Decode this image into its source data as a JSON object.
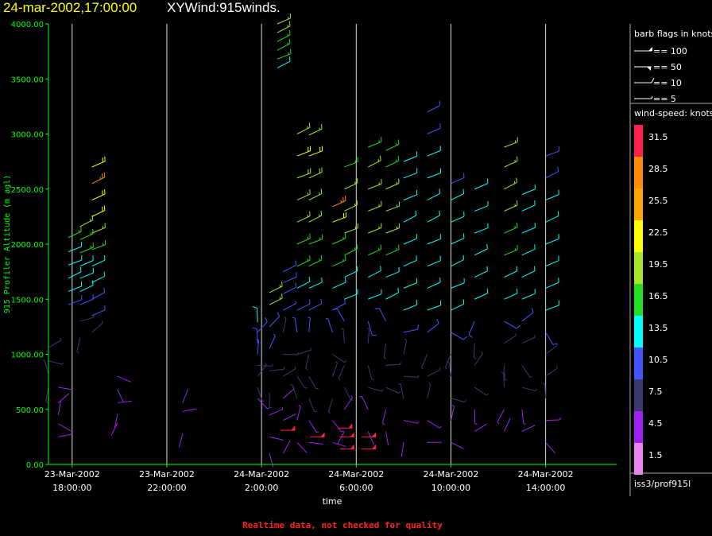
{
  "header": {
    "title_date": "24-mar-2002,17:00:00",
    "title_name": "XYWind:915winds."
  },
  "footer": {
    "quality_note": "Realtime data, not checked for quality"
  },
  "colors": {
    "background": "#000000",
    "axis": "#00ff00",
    "grid": "#ffffff",
    "title_date": "#ffff00",
    "quality_note": "#ff2222"
  },
  "chart_data": {
    "type": "wind-barb",
    "xlabel": "time",
    "ylabel": "915 Profiler Altitude (m agl)",
    "y_ticks": [
      "0.00",
      "500.00",
      "1000.00",
      "1500.00",
      "2000.00",
      "2500.00",
      "3000.00",
      "3500.00",
      "4000.00"
    ],
    "ylim": [
      0,
      4000
    ],
    "x_ticks": [
      {
        "date": "23-Mar-2002",
        "time": "18:00:00"
      },
      {
        "date": "23-Mar-2002",
        "time": "22:00:00"
      },
      {
        "date": "24-Mar-2002",
        "time": "2:00:00"
      },
      {
        "date": "24-Mar-2002",
        "time": "6:00:00"
      },
      {
        "date": "24-Mar-2002",
        "time": "10:00:00"
      },
      {
        "date": "24-Mar-2002",
        "time": "14:00:00"
      }
    ],
    "xlim": [
      "2002-03-23 17:00",
      "2002-03-24 17:00"
    ],
    "grid": "vertical",
    "legend": {
      "barb_title": "barb flags in knots",
      "barb_items": [
        "== 100",
        "== 50",
        "== 10",
        "== 5"
      ],
      "speed_title": "wind-speed: knots",
      "speed_levels": [
        "31.5",
        "28.5",
        "25.5",
        "22.5",
        "19.5",
        "16.5",
        "13.5",
        "10.5",
        "7.5",
        "4.5",
        "1.5"
      ],
      "speed_colors": [
        "#ff2050",
        "#ff8c00",
        "#ffa500",
        "#ffff00",
        "#a8e62e",
        "#22dd22",
        "#00ffff",
        "#4455ff",
        "#3a3a70",
        "#a020f0",
        "#ee82ee"
      ],
      "station": "iss3/prof915l"
    },
    "profiles": [
      {
        "time": "2002-03-23 17:00",
        "heights": [
          700,
          820,
          940,
          1060
        ],
        "speeds": [
          7,
          7,
          7,
          7
        ]
      },
      {
        "time": "2002-03-23 17:25",
        "heights": [
          250,
          370,
          450,
          560,
          700
        ],
        "speeds": [
          4,
          4,
          4,
          4,
          4
        ]
      },
      {
        "time": "2002-03-23 17:50",
        "heights": [
          1450,
          1570,
          1690,
          1810,
          1930,
          2060
        ],
        "speeds": [
          10,
          12,
          13,
          13,
          14,
          17
        ]
      },
      {
        "time": "2002-03-23 18:20",
        "heights": [
          1150,
          1300,
          1450,
          1570,
          1690,
          1800,
          1920,
          2040,
          2160
        ],
        "speeds": [
          7,
          8,
          10,
          12,
          13,
          14,
          16,
          17,
          19
        ]
      },
      {
        "time": "2002-03-23 18:50",
        "heights": [
          1200,
          1350,
          1500,
          1650,
          1800,
          1950,
          2100,
          2250,
          2400,
          2550,
          2700
        ],
        "speeds": [
          8,
          10,
          11,
          12,
          14,
          17,
          19,
          21,
          23,
          27,
          21
        ]
      },
      {
        "time": "2002-03-23 19:55",
        "heights": [
          380,
          460,
          560,
          680,
          800
        ],
        "speeds": [
          4,
          4,
          4,
          4,
          4
        ]
      },
      {
        "time": "2002-03-23 22:40",
        "heights": [
          280,
          480,
          560
        ],
        "speeds": [
          3,
          4,
          4
        ]
      },
      {
        "time": "2002-03-24 01:50",
        "heights": [
          600,
          700,
          800,
          900,
          1000,
          1100,
          1200,
          1290
        ],
        "speeds": [
          5,
          6,
          7,
          8,
          9,
          10,
          11,
          12
        ]
      },
      {
        "time": "2002-03-24 02:20",
        "heights": [
          100,
          250,
          450,
          650,
          850,
          1050,
          1250,
          1450,
          1560
        ],
        "speeds": [
          4,
          4,
          5,
          6,
          8,
          9,
          10,
          18,
          19
        ]
      },
      {
        "time": "2002-03-24 02:40",
        "heights": [
          3600,
          3680,
          3760,
          3840,
          3920,
          4000
        ],
        "speeds": [
          14,
          15,
          16,
          16,
          18,
          19
        ]
      },
      {
        "time": "2002-03-24 02:55",
        "heights": [
          100,
          400,
          600,
          800,
          1000,
          1200,
          1400,
          1550,
          1650,
          1750
        ],
        "speeds": [
          4,
          4,
          5,
          6,
          7,
          8,
          9,
          10,
          10,
          11
        ]
      },
      {
        "time": "2002-03-24 03:30",
        "heights": [
          200,
          400,
          600,
          800,
          1000,
          1200,
          1400,
          1600,
          1800,
          2000,
          2200,
          2400,
          2600,
          2800,
          3000
        ],
        "speeds": [
          4,
          5,
          6,
          7,
          8,
          9,
          10,
          12,
          15,
          16,
          18,
          19,
          20,
          21,
          19
        ]
      },
      {
        "time": "2002-03-24 04:00",
        "heights": [
          200,
          400,
          600,
          800,
          1000,
          1200,
          1400,
          1600,
          1800,
          2000,
          2200,
          2400,
          2600,
          2800,
          2990
        ],
        "speeds": [
          4,
          5,
          6,
          7,
          8,
          9,
          10,
          12,
          15,
          16,
          18,
          19,
          20,
          21,
          19
        ]
      },
      {
        "time": "2002-03-24 05:00",
        "heights": [
          200,
          400,
          600,
          800,
          1000,
          1200,
          1400,
          1600,
          1800,
          2000,
          2200,
          2340
        ],
        "speeds": [
          4,
          5,
          6,
          7,
          8,
          9,
          11,
          13,
          15,
          17,
          23,
          28
        ]
      },
      {
        "time": "2002-03-24 05:30",
        "heights": [
          300,
          500,
          700,
          900,
          1100,
          1300,
          1500,
          1700,
          1900,
          2100,
          2300,
          2500,
          2700
        ],
        "speeds": [
          4,
          5,
          6,
          7,
          8,
          10,
          12,
          14,
          16,
          18,
          19,
          19,
          17
        ]
      },
      {
        "time": "2002-03-24 06:30",
        "heights": [
          300,
          500,
          700,
          900,
          1100,
          1300,
          1500,
          1700,
          1900,
          2100,
          2300,
          2500,
          2700,
          2880
        ],
        "speeds": [
          4,
          5,
          6,
          7,
          8,
          10,
          12,
          14,
          16,
          18,
          19,
          19,
          18,
          17
        ]
      },
      {
        "time": "2002-03-24 07:15",
        "heights": [
          300,
          500,
          700,
          900,
          1100,
          1300,
          1500,
          1700,
          1900,
          2100,
          2300,
          2500,
          2700,
          2850
        ],
        "speeds": [
          4,
          5,
          6,
          7,
          8,
          10,
          12,
          14,
          16,
          18,
          19,
          18,
          17,
          16
        ]
      },
      {
        "time": "2002-03-24 08:00",
        "heights": [
          200,
          400,
          600,
          800,
          1000,
          1200,
          1400,
          1600,
          1800,
          2000,
          2200,
          2400,
          2600,
          2750
        ],
        "speeds": [
          4,
          5,
          6,
          7,
          8,
          10,
          12,
          13,
          14,
          14,
          14,
          14,
          14,
          14
        ]
      },
      {
        "time": "2002-03-24 09:00",
        "heights": [
          200,
          400,
          600,
          800,
          1000,
          1200,
          1400,
          1600,
          1800,
          2000,
          2200,
          2400,
          2600,
          2800,
          3000,
          3200
        ],
        "speeds": [
          4,
          5,
          6,
          7,
          8,
          10,
          12,
          13,
          14,
          14,
          14,
          14,
          13,
          12,
          11,
          10
        ]
      },
      {
        "time": "2002-03-24 10:00",
        "heights": [
          200,
          400,
          600,
          800,
          1000,
          1200,
          1400,
          1600,
          1800,
          2000,
          2200,
          2400,
          2550
        ],
        "speeds": [
          4,
          5,
          6,
          7,
          8,
          10,
          12,
          13,
          14,
          14,
          13,
          12,
          11
        ]
      },
      {
        "time": "2002-03-24 11:00",
        "heights": [
          300,
          500,
          700,
          900,
          1100,
          1300,
          1500,
          1700,
          1900,
          2100,
          2300,
          2500
        ],
        "speeds": [
          4,
          5,
          6,
          7,
          8,
          10,
          12,
          13,
          14,
          14,
          13,
          12
        ]
      },
      {
        "time": "2002-03-24 12:15",
        "heights": [
          300,
          500,
          700,
          900,
          1100,
          1300,
          1500,
          1700,
          1900,
          2100,
          2300,
          2500,
          2700,
          2880
        ],
        "speeds": [
          4,
          5,
          6,
          7,
          8,
          10,
          12,
          14,
          16,
          17,
          18,
          19,
          19,
          18
        ]
      },
      {
        "time": "2002-03-24 13:00",
        "heights": [
          300,
          500,
          700,
          900,
          1100,
          1300,
          1500,
          1700,
          1900,
          2100,
          2300,
          2450
        ],
        "speeds": [
          4,
          5,
          6,
          7,
          8,
          10,
          12,
          13,
          14,
          14,
          13,
          12
        ]
      },
      {
        "time": "2002-03-24 14:00",
        "heights": [
          200,
          400,
          600,
          800,
          1000,
          1200,
          1400,
          1600,
          1800,
          2000,
          2200,
          2400,
          2600,
          2800
        ],
        "speeds": [
          4,
          5,
          6,
          7,
          8,
          10,
          12,
          13,
          14,
          14,
          13,
          12,
          11,
          10
        ]
      }
    ],
    "low_level_flags": [
      {
        "time": "2002-03-24 03:25",
        "height": 310,
        "speed": 31
      },
      {
        "time": "2002-03-24 04:40",
        "height": 250,
        "speed": 31
      },
      {
        "time": "2002-03-24 05:50",
        "height": 330,
        "speed": 31
      },
      {
        "time": "2002-03-24 05:55",
        "height": 250,
        "speed": 31
      },
      {
        "time": "2002-03-24 05:55",
        "height": 140,
        "speed": 31
      },
      {
        "time": "2002-03-24 06:50",
        "height": 250,
        "speed": 31
      },
      {
        "time": "2002-03-24 06:50",
        "height": 140,
        "speed": 31
      }
    ]
  }
}
